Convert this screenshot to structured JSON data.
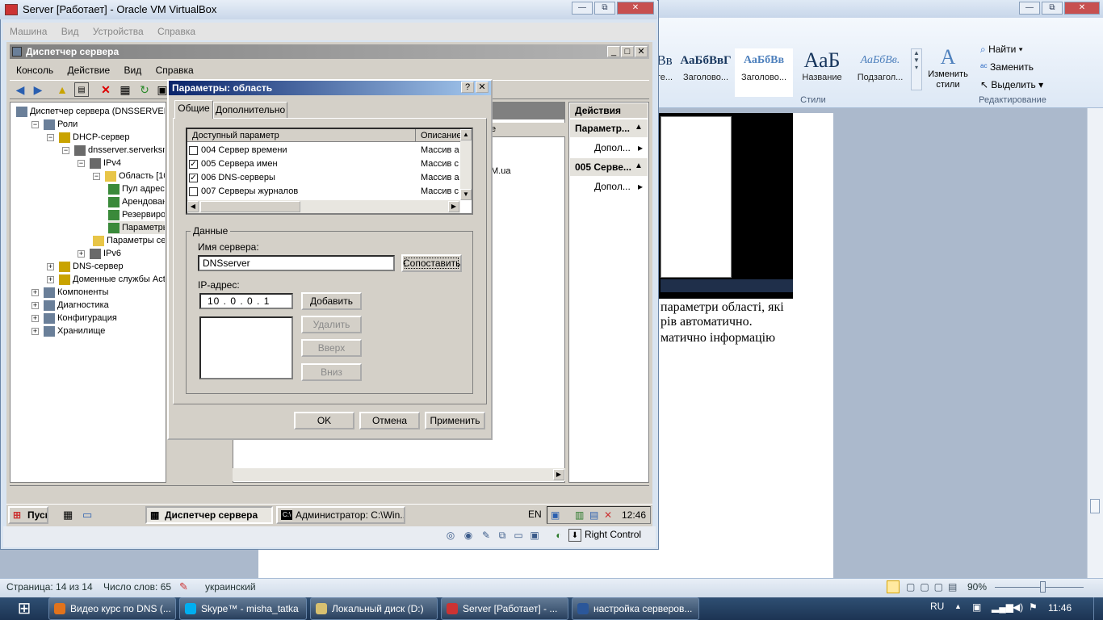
{
  "colors": {
    "vbox_accent": "#0a246a",
    "taskbar": "#1c3453"
  },
  "vbox": {
    "title": "Server [Работает] - Oracle VM VirtualBox",
    "title_controls": [
      "—",
      "⧉",
      "✕"
    ],
    "menu": [
      "Машина",
      "Вид",
      "Устройства",
      "Справка"
    ],
    "right_control": "Right Control"
  },
  "word": {
    "title_controls": [
      "—",
      "⧉",
      "✕"
    ],
    "help_icon": "?",
    "styles": [
      {
        "sample": "АаБбВвГ",
        "name": "Заголово..."
      },
      {
        "sample": "АаБбВв",
        "name": "Заголово..."
      },
      {
        "sample": "АаБ",
        "name": "Название"
      },
      {
        "sample": "АаБбВв.",
        "name": "Подзагол..."
      }
    ],
    "style_partial": "Вв",
    "style_partial_label": "те...",
    "change_styles": "Изменить стили",
    "styles_group": "Стили",
    "find": "Найти",
    "replace": "Заменить",
    "select": "Выделить",
    "edit_group": "Редактирование",
    "doc_lines": [
      "параметри області, які",
      "рів автоматично.",
      "матично інформацію"
    ],
    "status": {
      "page": "Страница: 14 из 14",
      "words": "Число слов: 65",
      "lang": "украинский",
      "zoom": "90%"
    }
  },
  "server_manager": {
    "title": "Диспетчер сервера",
    "title_controls": [
      "_",
      "□",
      "✕"
    ],
    "menu": [
      "Консоль",
      "Действие",
      "Вид",
      "Справка"
    ],
    "tree": [
      {
        "label": "Диспетчер сервера (DNSSERVER)",
        "level": 0,
        "exp": ""
      },
      {
        "label": "Роли",
        "level": 1,
        "exp": "−"
      },
      {
        "label": "DHCP-сервер",
        "level": 2,
        "exp": "−"
      },
      {
        "label": "dnsserver.serverksm.ua",
        "level": 3,
        "exp": "−"
      },
      {
        "label": "IPv4",
        "level": 4,
        "exp": "−"
      },
      {
        "label": "Область [10.0.0.0]",
        "level": 5,
        "exp": "−"
      },
      {
        "label": "Пул адресов",
        "level": 6,
        "exp": ""
      },
      {
        "label": "Арендованные адреса",
        "level": 6,
        "exp": ""
      },
      {
        "label": "Резервирования",
        "level": 6,
        "exp": ""
      },
      {
        "label": "Параметры области",
        "level": 6,
        "exp": ""
      },
      {
        "label": "Параметры сервера",
        "level": 5,
        "exp": ""
      },
      {
        "label": "IPv6",
        "level": 4,
        "exp": "+"
      },
      {
        "label": "DNS-сервер",
        "level": 2,
        "exp": "+"
      },
      {
        "label": "Доменные службы Active Directory",
        "level": 2,
        "exp": "+"
      },
      {
        "label": "Компоненты",
        "level": 1,
        "exp": "+"
      },
      {
        "label": "Диагностика",
        "level": 1,
        "exp": "+"
      },
      {
        "label": "Конфигурация",
        "level": 1,
        "exp": "+"
      },
      {
        "label": "Хранилище",
        "level": 1,
        "exp": "+"
      }
    ],
    "center_col": "е",
    "center_val": "M.ua",
    "actions": {
      "header": "Действия",
      "sub1": "Параметр...",
      "item1": "Допол...",
      "sub2": "005 Серве...",
      "item2": "Допол..."
    }
  },
  "vm_taskbar": {
    "start": "Пуск",
    "tasks": [
      "Диспетчер сервера",
      "Администратор: C:\\Win..."
    ],
    "lang": "EN",
    "time": "12:46"
  },
  "dialog": {
    "title": "Параметры: область",
    "help": "?",
    "close": "✕",
    "tabs": [
      "Общие",
      "Дополнительно"
    ],
    "list_cols": [
      "Доступный параметр",
      "Описание"
    ],
    "options": [
      {
        "label": "004 Сервер времени",
        "desc": "Массив а",
        "checked": false
      },
      {
        "label": "005 Сервера имен",
        "desc": "Массив с",
        "checked": true
      },
      {
        "label": "006 DNS-серверы",
        "desc": "Массив а",
        "checked": true
      },
      {
        "label": "007 Серверы журналов",
        "desc": "Массив с",
        "checked": false
      }
    ],
    "data_legend": "Данные",
    "server_name_label": "Имя сервера:",
    "server_name_value": "DNSserver",
    "resolve": "Сопоставить",
    "ip_label": "IP-адрес:",
    "ip_value": "10 . 0 . 0 . 1",
    "add": "Добавить",
    "remove": "Удалить",
    "up": "Вверх",
    "down": "Вниз",
    "ok": "OK",
    "cancel": "Отмена",
    "apply": "Применить"
  },
  "taskbar": {
    "tasks": [
      "Видео курс по DNS (...",
      "Skype™ - misha_tatka",
      "Локальный диск (D:)",
      "Server [Работает] - ...",
      "настройка серверов..."
    ],
    "lang": "RU",
    "time": "11:46"
  }
}
